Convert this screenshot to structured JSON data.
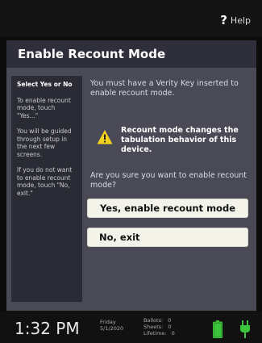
{
  "topbar": {
    "help_label": "Help",
    "help_icon": "?"
  },
  "title": "Enable Recount Mode",
  "sidebar": {
    "heading": "Select Yes or No",
    "paragraphs": [
      "To enable recount mode, touch \"Yes...\"",
      "You will be guided through setup in the next few screens.",
      "If you do not want to enable recount mode, touch \"No, exit.\""
    ]
  },
  "content": {
    "key_message": "You must have a Verity Key inserted to enable recount mode.",
    "warning": "Recount mode changes the tabulation behavior of this device.",
    "question": "Are you sure you want to enable recount mode?"
  },
  "buttons": {
    "yes": "Yes, enable recount mode",
    "no": "No, exit"
  },
  "status": {
    "time": "1:32 PM",
    "day": "Friday",
    "date": "5/1/2020",
    "ballots_label": "Ballots:",
    "ballots": "0",
    "sheets_label": "Sheets:",
    "sheets": "0",
    "lifetime_label": "Lifetime:",
    "lifetime": "0"
  },
  "colors": {
    "accent_green": "#3cc43c",
    "warning_yellow": "#f2d21e",
    "panel": "#4a4a56"
  },
  "icons": [
    "help-icon",
    "warning-icon",
    "battery-icon",
    "power-plug-icon"
  ]
}
